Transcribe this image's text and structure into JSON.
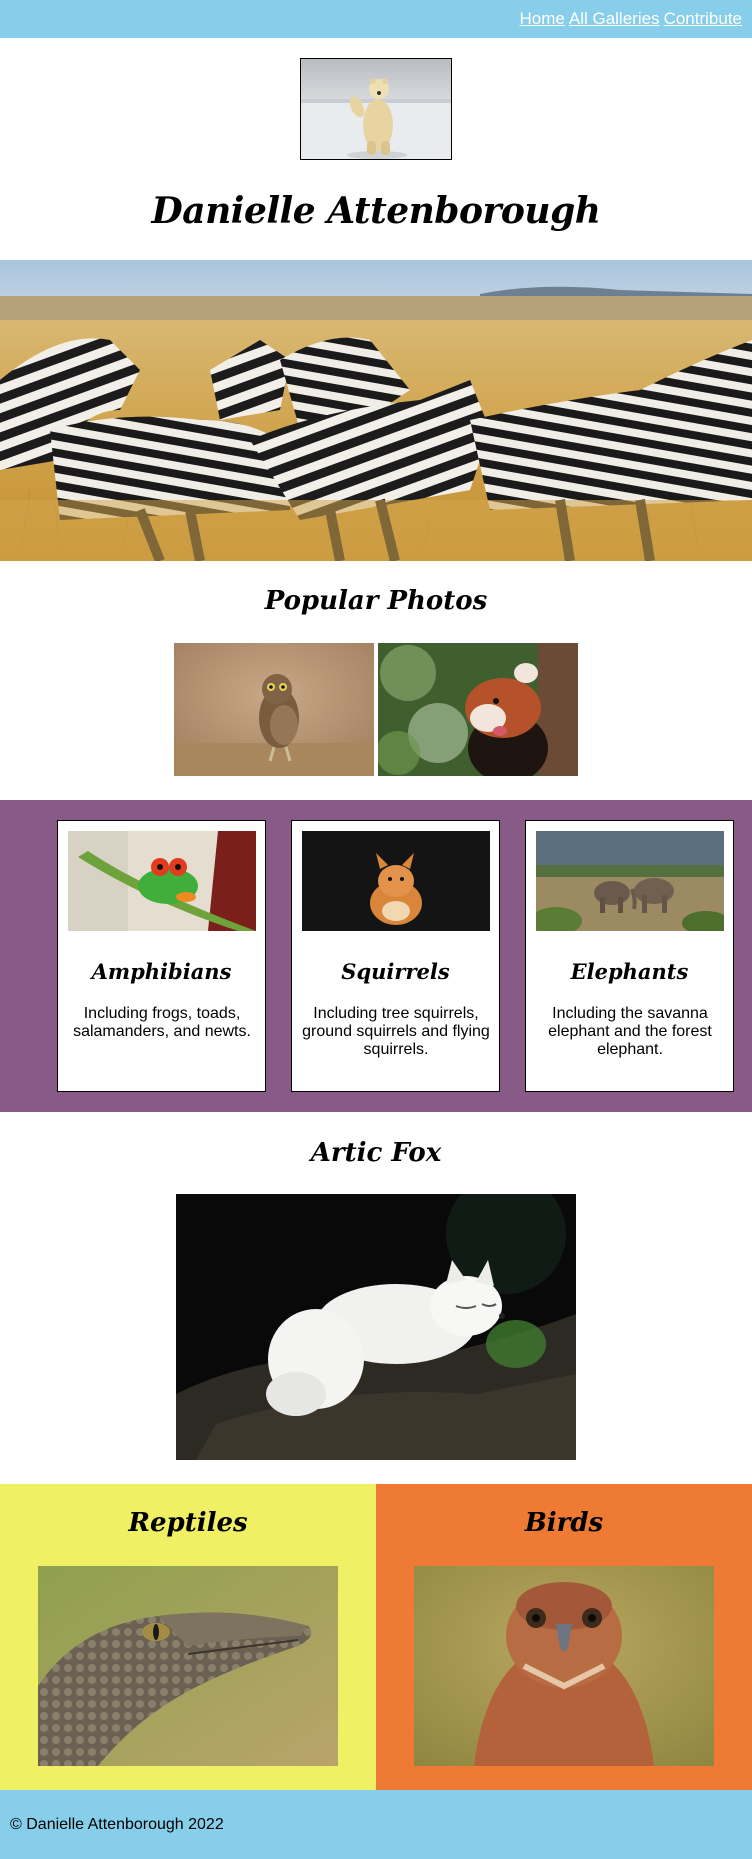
{
  "nav": {
    "links": [
      "Home",
      "All Galleries",
      "Contribute"
    ]
  },
  "header": {
    "title": "Danielle Attenborough"
  },
  "popular": {
    "title": "Popular Photos"
  },
  "cards": [
    {
      "title": "Amphibians",
      "text": "Including frogs, toads, salamanders, and newts."
    },
    {
      "title": "Squirrels",
      "text": "Including tree squirrels, ground squirrels and flying squirrels."
    },
    {
      "title": "Elephants",
      "text": "Including the savanna elephant and the forest elephant."
    }
  ],
  "feature": {
    "title": "Artic Fox"
  },
  "split": {
    "left": {
      "title": "Reptiles"
    },
    "right": {
      "title": "Birds"
    }
  },
  "footer": {
    "text": "© Danielle Attenborough 2022"
  },
  "colors": {
    "nav": "#87ceeb",
    "cards_band": "#875a87",
    "reptiles": "#f0f065",
    "birds": "#ee7a33",
    "footer": "#87ceeb"
  }
}
